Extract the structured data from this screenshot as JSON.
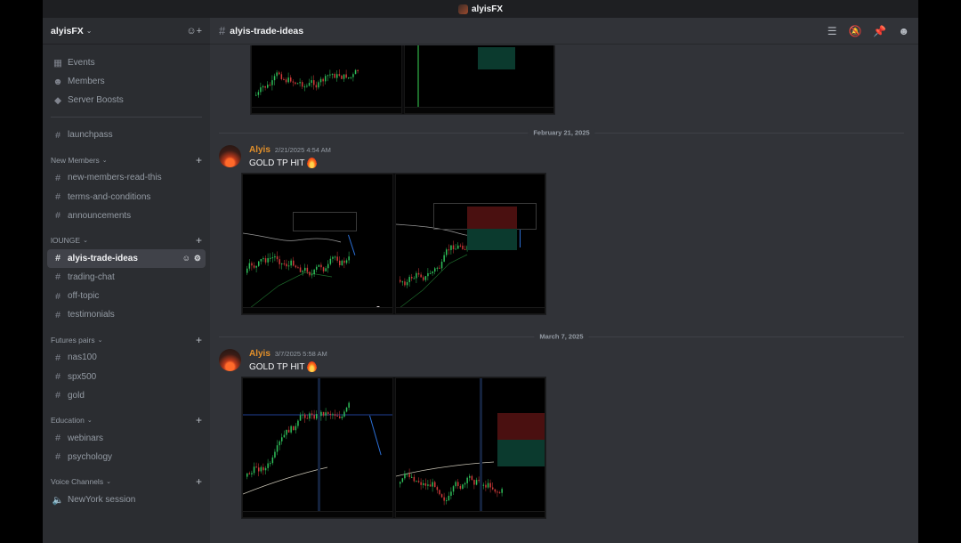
{
  "window": {
    "title": "alyisFX"
  },
  "server": {
    "name": "alyisFX"
  },
  "sidebar": {
    "top_items": [
      {
        "label": "Events",
        "icon": "calendar-icon"
      },
      {
        "label": "Members",
        "icon": "members-icon"
      },
      {
        "label": "Server Boosts",
        "icon": "boost-icon"
      }
    ],
    "uncategorized": [
      {
        "label": "launchpass"
      }
    ],
    "categories": [
      {
        "name": "New Members",
        "channels": [
          "new-members-read-this",
          "terms-and-conditions",
          "announcements"
        ]
      },
      {
        "name": "lOUNGE",
        "channels": [
          "alyis-trade-ideas",
          "trading-chat",
          "off-topic",
          "testimonials"
        ]
      },
      {
        "name": "Futures pairs",
        "channels": [
          "nas100",
          "spx500",
          "gold"
        ]
      },
      {
        "name": "Education",
        "channels": [
          "webinars",
          "psychology"
        ]
      },
      {
        "name": "Voice Channels",
        "channels": [
          "NewYork session"
        ]
      }
    ],
    "active_channel": "alyis-trade-ideas"
  },
  "header": {
    "channel": "alyis-trade-ideas",
    "tools": [
      "threads-icon",
      "notifications-muted-icon",
      "pin-icon",
      "member-list-icon"
    ]
  },
  "messages": [
    {
      "divider": "February 21, 2025",
      "author": "Alyis",
      "timestamp": "2/21/2025 4:54 AM",
      "text": "GOLD TP HIT",
      "emoji": "fire-icon"
    },
    {
      "divider": "March 7, 2025",
      "author": "Alyis",
      "timestamp": "3/7/2025 5:58 AM",
      "text": "GOLD TP HIT",
      "emoji": "fire-icon"
    }
  ],
  "colors": {
    "accent_author": "#e3902a",
    "bg_sidebar": "#2b2d31",
    "bg_main": "#313338",
    "active_item": "#404249",
    "stop_zone": "#4a1010",
    "target_zone": "#0b3a2e"
  }
}
